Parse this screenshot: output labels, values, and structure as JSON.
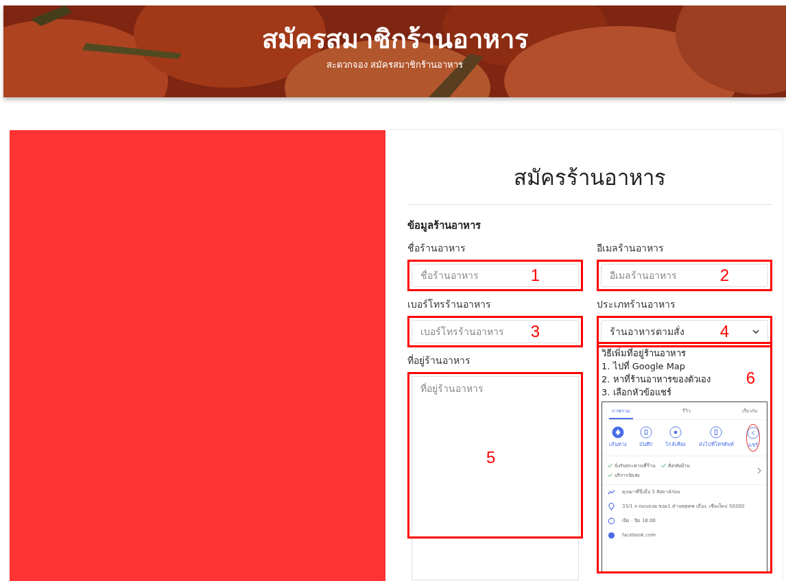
{
  "header": {
    "title": "สมัครสมาชิกร้านอาหาร",
    "subtitle": "สะดวกจอง สมัครสมาชิกร้านอาหาร"
  },
  "form": {
    "title": "สมัครร้านอาหาร",
    "section_heading": "ข้อมูลร้านอาหาร",
    "fields": [
      {
        "kind": "text",
        "label": "ชื่อร้านอาหาร",
        "placeholder": "ชื่อร้านอาหาร",
        "annotation": "1"
      },
      {
        "kind": "text",
        "label": "อีเมลร้านอาหาร",
        "placeholder": "อีเมลร้านอาหาร",
        "annotation": "2"
      },
      {
        "kind": "text",
        "label": "เบอร์โทรร้านอาหาร",
        "placeholder": "เบอร์โทรร้านอาหาร",
        "annotation": "3"
      },
      {
        "kind": "select",
        "label": "ประเภทร้านอาหาร",
        "value": "ร้านอาหารตามสั่ง",
        "annotation": "4"
      },
      {
        "kind": "textarea",
        "label": "ที่อยู่ร้านอาหาร",
        "placeholder": "ที่อยู่ร้านอาหาร",
        "annotation": "5"
      }
    ],
    "instructions": {
      "annotation": "6",
      "lines": [
        "วิธีเพิ่มที่อยู่ร้านอาหาร",
        "1. ไปที่ Google Map",
        "2. หาที่ร้านอาหารของตัวเอง",
        "3. เลือกหัวข้อแชร์"
      ]
    },
    "map_preview": {
      "tabs": [
        {
          "label": "ภาพรวม",
          "selected": true
        },
        {
          "label": "รีวิว",
          "selected": false
        },
        {
          "label": "เกี่ยวกับ",
          "selected": false
        }
      ],
      "actions": [
        {
          "label": "เส้นทาง",
          "kind": "primary",
          "circled": false
        },
        {
          "label": "บันทึก",
          "kind": "bookmark",
          "circled": false
        },
        {
          "label": "ใกล้เคียง",
          "kind": "nearby",
          "circled": false
        },
        {
          "label": "ส่งไปที่โทรศัพท์",
          "kind": "phone",
          "circled": false
        },
        {
          "label": "แชร์",
          "kind": "share",
          "circled": true
        }
      ],
      "features": [
        "นั่งรับประทานที่ร้าน",
        "สั่งกลับบ้าน",
        "บริการจัดส่ง"
      ],
      "details": [
        {
          "kind": "trend",
          "text": "คุณมาที่นี่เมื่อ 3 สัปดาห์ก่อน"
        },
        {
          "kind": "pin",
          "text": "33/1 ถ ถนนดอย ซอย1 ตำบลสุเทพ เมือง, เชียงใหม่ 50200"
        },
        {
          "kind": "clock",
          "text": "เปิด · ปิด 18:00"
        },
        {
          "kind": "globe",
          "text": "facebook.com"
        }
      ]
    }
  }
}
